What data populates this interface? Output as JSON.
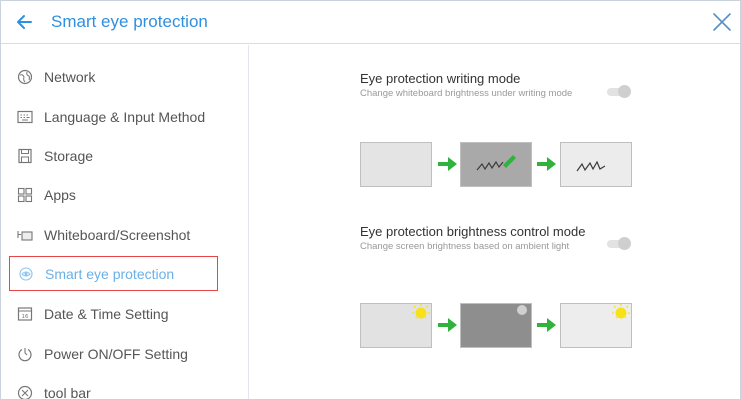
{
  "header": {
    "back_icon": "arrow-left-icon",
    "title": "Smart eye protection",
    "close_icon": "close-icon",
    "accent": "#2f8fe0"
  },
  "sidebar": {
    "items": [
      {
        "label": "Network",
        "icon": "globe-icon",
        "active": false
      },
      {
        "label": "Language & Input Method",
        "icon": "keyboard-icon",
        "active": false
      },
      {
        "label": "Storage",
        "icon": "storage-icon",
        "active": false
      },
      {
        "label": "Apps",
        "icon": "apps-icon",
        "active": false
      },
      {
        "label": "Whiteboard/Screenshot",
        "icon": "whiteboard-icon",
        "active": false
      },
      {
        "label": "Smart eye protection",
        "icon": "eye-protection-icon",
        "active": true
      },
      {
        "label": "Date & Time Setting",
        "icon": "calendar-icon",
        "active": false
      },
      {
        "label": "Power ON/OFF Setting",
        "icon": "power-icon",
        "active": false
      },
      {
        "label": "tool bar",
        "icon": "toolbar-icon",
        "active": false
      }
    ],
    "highlight_color": "#e64646"
  },
  "settings": [
    {
      "title": "Eye protection writing mode",
      "description": "Change whiteboard brightness under writing mode",
      "enabled": false,
      "illustration": "writing-mode-illustration"
    },
    {
      "title": "Eye protection brightness control mode",
      "description": "Change screen brightness based on ambient light",
      "enabled": false,
      "illustration": "brightness-mode-illustration"
    }
  ],
  "colors": {
    "arrow_green": "#2fb33c",
    "sun_yellow": "#f7e21a"
  }
}
